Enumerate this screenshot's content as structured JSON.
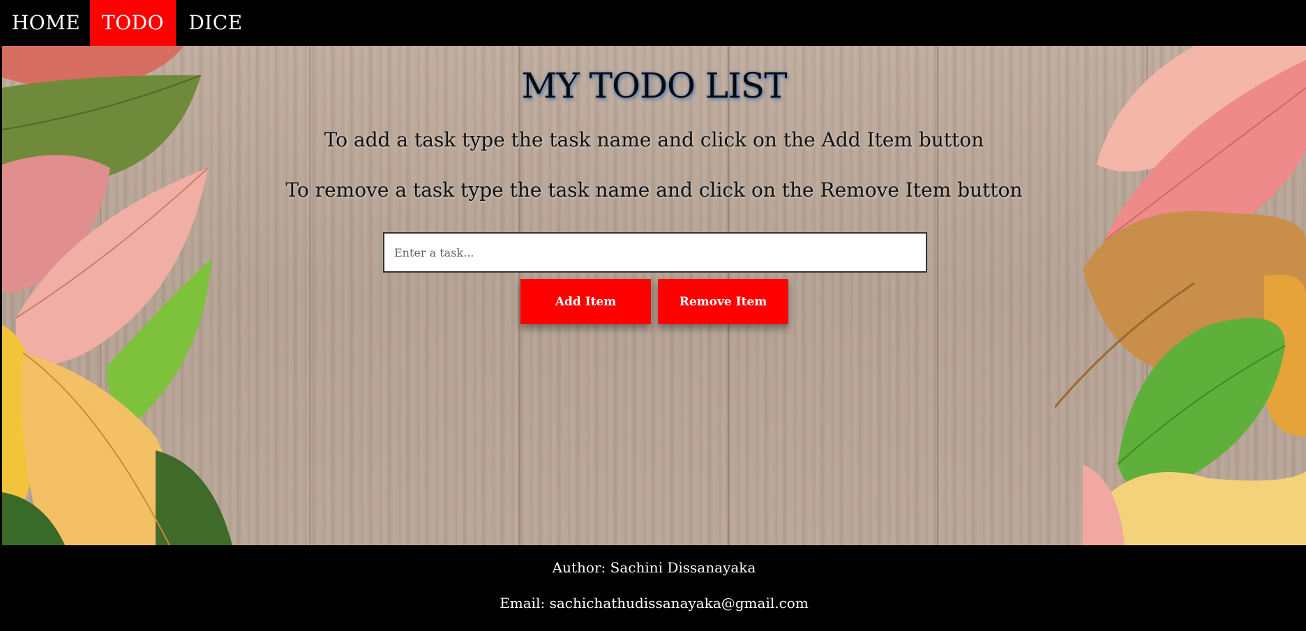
{
  "nav": {
    "items": [
      {
        "label": "HOME",
        "active": false
      },
      {
        "label": "TODO",
        "active": true
      },
      {
        "label": "DICE",
        "active": false
      }
    ],
    "active_color": "#ff0000"
  },
  "main": {
    "title": "MY TODO LIST",
    "instruction_add": "To add a task type the task name and click on the Add Item button",
    "instruction_remove": "To remove a task type the task name and click on the Remove Item button",
    "task_input": {
      "placeholder": "Enter a task...",
      "value": ""
    },
    "add_button": "Add Item",
    "remove_button": "Remove Item",
    "button_color": "#ff0000"
  },
  "footer": {
    "author": "Author: Sachini Dissanayaka",
    "email": "Email: sachichathudissanayaka@gmail.com"
  }
}
